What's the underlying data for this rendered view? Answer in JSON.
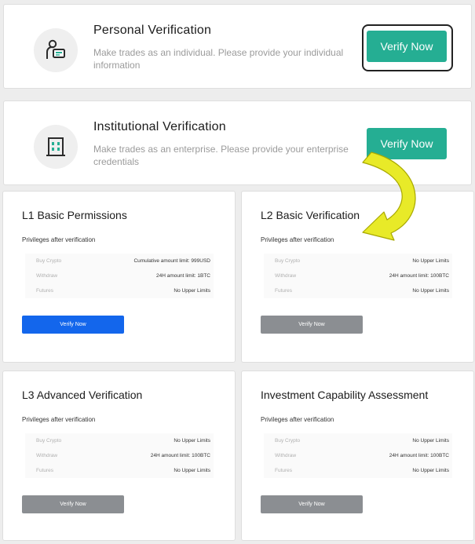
{
  "verification_cards": {
    "personal": {
      "title": "Personal Verification",
      "description": "Make trades as an individual. Please provide your individual information",
      "button": "Verify Now"
    },
    "institutional": {
      "title": "Institutional Verification",
      "description": "Make trades as an enterprise. Please provide your enterprise credentials",
      "button": "Verify Now"
    }
  },
  "levels": [
    {
      "title": "L1 Basic Permissions",
      "subtitle": "Privileges after verification",
      "rows": [
        {
          "label": "Buy Crypto",
          "value": "Cumulative amount limit: 999USD"
        },
        {
          "label": "Withdraw",
          "value": "24H amount limit: 1BTC"
        },
        {
          "label": "Futures",
          "value": "No Upper Limits"
        }
      ],
      "button": "Verify Now",
      "button_state": "primary"
    },
    {
      "title": "L2 Basic Verification",
      "subtitle": "Privileges after verification",
      "rows": [
        {
          "label": "Buy Crypto",
          "value": "No Upper Limits"
        },
        {
          "label": "Withdraw",
          "value": "24H amount limit: 100BTC"
        },
        {
          "label": "Futures",
          "value": "No Upper Limits"
        }
      ],
      "button": "Verify Now",
      "button_state": "disabled"
    },
    {
      "title": "L3 Advanced Verification",
      "subtitle": "Privileges after verification",
      "rows": [
        {
          "label": "Buy Crypto",
          "value": "No Upper Limits"
        },
        {
          "label": "Withdraw",
          "value": "24H amount limit: 100BTC"
        },
        {
          "label": "Futures",
          "value": "No Upper Limits"
        }
      ],
      "button": "Verify Now",
      "button_state": "disabled"
    },
    {
      "title": "Investment Capability Assessment",
      "subtitle": "Privileges after verification",
      "rows": [
        {
          "label": "Buy Crypto",
          "value": "No Upper Limits"
        },
        {
          "label": "Withdraw",
          "value": "24H amount limit: 100BTC"
        },
        {
          "label": "Futures",
          "value": "No Upper Limits"
        }
      ],
      "button": "Verify Now",
      "button_state": "disabled"
    }
  ],
  "colors": {
    "accent_green": "#25ae93",
    "primary_blue": "#1366ec",
    "disabled_gray": "#8b8e92",
    "annotation_arrow": "#e8ea28"
  },
  "icons": {
    "personal": "person-id-icon",
    "institutional": "building-icon",
    "annotation": "curved-arrow-annotation"
  }
}
